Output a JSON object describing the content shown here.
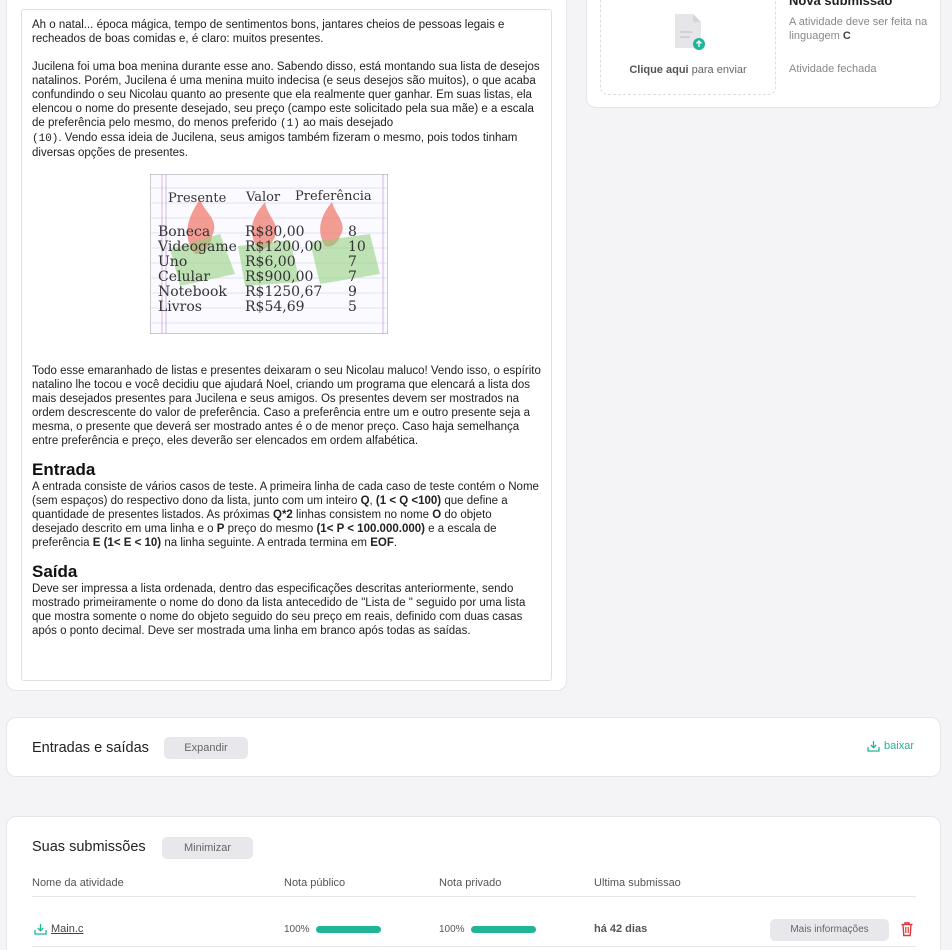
{
  "description": {
    "p1": "Ah o natal... época mágica, tempo de sentimentos bons, jantares cheios de pessoas legais e recheados de boas comidas e, é claro: muitos presentes.",
    "p2_a": "Jucilena foi uma boa menina durante esse ano. Sabendo disso, está montando sua lista de desejos natalinos. Porém, Jucilena é uma menina muito indecisa (e seus desejos são muitos), o que acaba confundindo o seu Nicolau quanto ao presente que ela realmente quer ganhar. Em suas listas, ela elencou o nome do presente desejado, seu preço (campo este solicitado pela sua mãe) e a escala de preferência pelo mesmo, do menos preferido ",
    "p2_code1": "(1)",
    "p2_b": " ao mais desejado ",
    "p2_code2": "(10)",
    "p2_c": ". Vendo essa ideia de Jucilena, seus amigos também fizeram o mesmo, pois todos tinham diversas opções de presentes.",
    "figure": {
      "header": [
        "Presente",
        "Valor",
        "Preferência"
      ],
      "rows": [
        [
          "Boneca",
          "R$80,00",
          "8"
        ],
        [
          "Videogame",
          "R$1200,00",
          "10"
        ],
        [
          "Uno",
          "R$6,00",
          "7"
        ],
        [
          "Celular",
          "R$900,00",
          "7"
        ],
        [
          "Notebook",
          "R$1250,67",
          "9"
        ],
        [
          "Livros",
          "R$54,69",
          "5"
        ]
      ]
    },
    "p3": "Todo esse emaranhado de listas e presentes deixaram o seu Nicolau maluco! Vendo isso, o espírito natalino lhe tocou e você decidiu que ajudará Noel, criando um programa que elencará a lista dos mais desejados presentes para Jucilena e seus amigos. Os presentes devem ser mostrados na ordem descrescente do valor de preferência. Caso a preferência entre um e outro presente seja a mesma, o presente que deverá ser mostrado antes é o de menor preço. Caso haja semelhança entre preferência e preço, eles deverão ser elencados em ordem alfabética.",
    "entrada_title": "Entrada",
    "entrada": {
      "t1": "A entrada consiste de vários casos de teste. A primeira linha de cada caso de teste contém o Nome (sem espaços) do respectivo dono da lista, junto com um inteiro ",
      "b1": "Q",
      "t2": ", ",
      "b2": "(1 < Q <100)",
      "t3": " que define a quantidade de presentes listados. As próximas ",
      "b3": "Q*2",
      "t4": " linhas consistem no nome ",
      "b4": "O",
      "t5": " do objeto desejado descrito em uma linha e o ",
      "b5": "P",
      "t6": " preço do mesmo ",
      "b6": "(1< P < 100.000.000)",
      "t7": " e a escala de preferência ",
      "b7": "E (1< E < 10)",
      "t8": " na linha seguinte. A entrada termina em ",
      "b8": "EOF",
      "t9": "."
    },
    "saida_title": "Saída",
    "saida": "Deve ser impressa a lista ordenada, dentro das especificações descritas anteriormente, sendo mostrado primeiramente o nome do dono da lista antecedido de \"Lista de \" seguido por uma lista que mostra somente o nome do objeto seguido do seu preço em reais, definido com duas casas após o ponto decimal. Deve ser mostrada uma linha em branco após todas as saídas."
  },
  "submission_panel": {
    "upload_bold": "Clique aqui",
    "upload_rest": " para enviar",
    "title": "Nova submissão",
    "desc_prefix": "A atividade deve ser feita na linguagem ",
    "language": "C",
    "status": "Atividade fechada"
  },
  "io_section": {
    "title": "Entradas e saídas",
    "expand_label": "Expandir",
    "download_label": "baixar"
  },
  "submissions": {
    "title": "Suas submissões",
    "minimize_label": "Minimizar",
    "columns": [
      "Nome da atividade",
      "Nota público",
      "Nota privado",
      "Ultima submissao"
    ],
    "rows": [
      {
        "file": "Main.c",
        "public_score": "100%",
        "public_fraction": 1.0,
        "private_score": "100%",
        "private_fraction": 1.0,
        "last": "há 42 dias",
        "more_label": "Mais informações"
      }
    ]
  },
  "colors": {
    "accent": "#21b598",
    "danger": "#d93b3b"
  }
}
